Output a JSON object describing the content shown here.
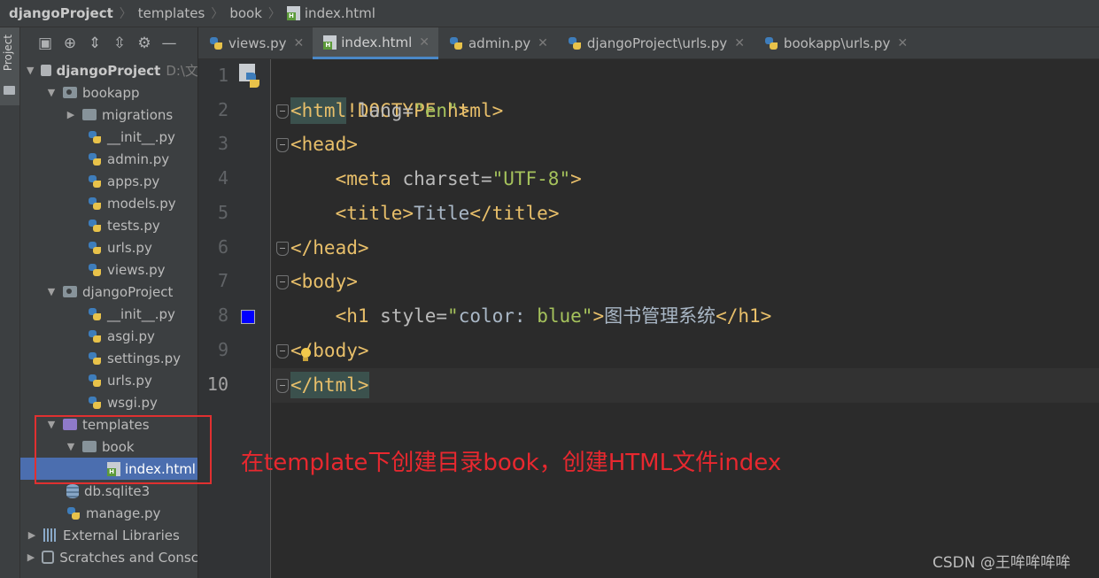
{
  "breadcrumb": {
    "items": [
      "djangoProject",
      "templates",
      "book",
      "index.html"
    ]
  },
  "left_stripe": {
    "project_tab_label": "Project"
  },
  "project_panel": {
    "toolbar_icons": [
      "panel-icon",
      "locate-icon",
      "expand-all-icon",
      "collapse-all-icon",
      "gear-icon",
      "minimize-icon"
    ],
    "tree": [
      {
        "label": "djangoProject",
        "suffix": "D:\\文",
        "kind": "root-folder"
      },
      {
        "label": "bookapp",
        "kind": "folder"
      },
      {
        "label": "migrations",
        "kind": "folder"
      },
      {
        "label": "__init__.py",
        "kind": "py"
      },
      {
        "label": "admin.py",
        "kind": "py"
      },
      {
        "label": "apps.py",
        "kind": "py"
      },
      {
        "label": "models.py",
        "kind": "py"
      },
      {
        "label": "tests.py",
        "kind": "py"
      },
      {
        "label": "urls.py",
        "kind": "py"
      },
      {
        "label": "views.py",
        "kind": "py"
      },
      {
        "label": "djangoProject",
        "kind": "folder"
      },
      {
        "label": "__init__.py",
        "kind": "py"
      },
      {
        "label": "asgi.py",
        "kind": "py"
      },
      {
        "label": "settings.py",
        "kind": "py"
      },
      {
        "label": "urls.py",
        "kind": "py"
      },
      {
        "label": "wsgi.py",
        "kind": "py"
      },
      {
        "label": "templates",
        "kind": "folder"
      },
      {
        "label": "book",
        "kind": "folder"
      },
      {
        "label": "index.html",
        "kind": "html"
      },
      {
        "label": "db.sqlite3",
        "kind": "db"
      },
      {
        "label": "manage.py",
        "kind": "py"
      },
      {
        "label": "External Libraries",
        "kind": "lib"
      },
      {
        "label": "Scratches and Consc",
        "kind": "scratch"
      }
    ]
  },
  "tabs": [
    {
      "label": "views.py",
      "icon": "python-file-icon",
      "active": false
    },
    {
      "label": "index.html",
      "icon": "html-file-icon",
      "active": true
    },
    {
      "label": "admin.py",
      "icon": "python-file-icon",
      "active": false
    },
    {
      "label": "djangoProject\\urls.py",
      "icon": "python-file-icon",
      "active": false
    },
    {
      "label": "bookapp\\urls.py",
      "icon": "python-file-icon",
      "active": false
    }
  ],
  "editor": {
    "line_numbers": [
      "1",
      "2",
      "3",
      "4",
      "5",
      "6",
      "7",
      "8",
      "9",
      "10"
    ],
    "current_line": "10",
    "color_swatch": "#0000ff",
    "lines": {
      "l1": "<!DOCTYPE html>",
      "l2_open": "<html",
      "l2_attr": " lang=",
      "l2_val": "\"en\"",
      "l2_close": ">",
      "l3": "<head>",
      "l4_open": "<meta",
      "l4_attr": " charset=",
      "l4_val": "\"UTF-8\"",
      "l4_close": ">",
      "l5_open": "<title>",
      "l5_text": "Title",
      "l5_close": "</title>",
      "l6": "</head>",
      "l7": "<body>",
      "l8_open": "<h1",
      "l8_attr": " style=",
      "l8_q1": "\"",
      "l8_prop": "color: ",
      "l8_val": "blue",
      "l8_q2": "\"",
      "l8_gt": ">",
      "l8_text": "图书管理系统",
      "l8_close": "</h1>",
      "l9": "</body>",
      "l10": "</html>"
    }
  },
  "annotation": {
    "text": "在template下创建目录book，创建HTML文件index",
    "color": "#e8282f"
  },
  "watermark": "CSDN @王哞哞哞哞"
}
